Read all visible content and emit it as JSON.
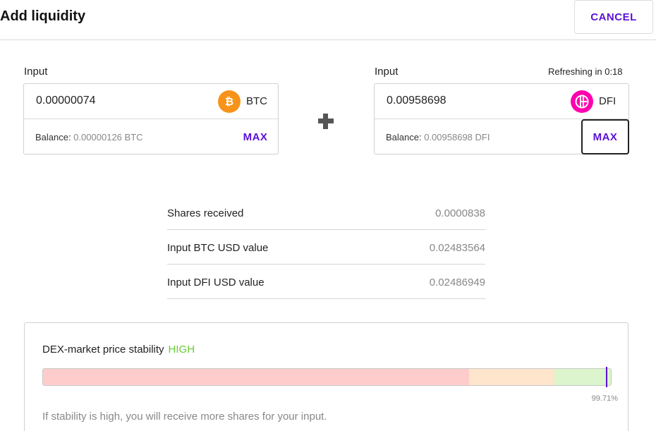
{
  "header": {
    "title": "Add liquidity",
    "cancel_label": "CANCEL"
  },
  "left_input": {
    "label": "Input",
    "amount": "0.00000074",
    "token": "BTC",
    "token_icon": "bitcoin-icon",
    "token_color": "#f7931a",
    "balance_label": "Balance:",
    "balance_value": "0.00000126 BTC",
    "max_label": "MAX"
  },
  "right_input": {
    "label": "Input",
    "refresh_text": "Refreshing in 0:18",
    "amount": "0.00958698",
    "token": "DFI",
    "token_icon": "defichain-icon",
    "token_color": "#ff00af",
    "balance_label": "Balance:",
    "balance_value": "0.00958698 DFI",
    "max_label": "MAX"
  },
  "summary": [
    {
      "label": "Shares received",
      "value": "0.0000838"
    },
    {
      "label": "Input BTC USD value",
      "value": "0.02483564"
    },
    {
      "label": "Input DFI USD value",
      "value": "0.02486949"
    }
  ],
  "stability": {
    "title": "DEX-market price stability",
    "level": "HIGH",
    "level_color": "#66cc33",
    "percent_label": "99.71%",
    "percent_value": 99.71,
    "note": "If stability is high, you will receive more shares for your input.",
    "segments": [
      {
        "name": "low",
        "fraction": 0.75,
        "color": "#ffcccc"
      },
      {
        "name": "medium",
        "fraction": 0.15,
        "color": "#ffe5cc"
      },
      {
        "name": "high",
        "fraction": 0.1,
        "color": "#dcf5cc"
      }
    ]
  }
}
